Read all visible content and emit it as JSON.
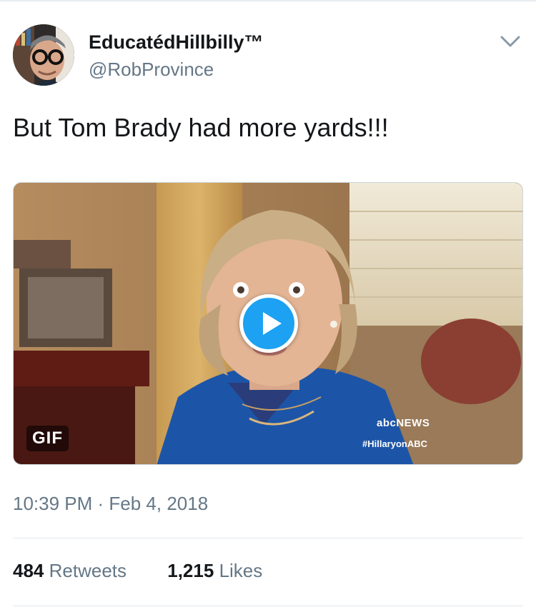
{
  "tweet": {
    "display_name": "EducatédHillbilly™",
    "handle": "@RobProvince",
    "text": "But Tom Brady had more yards!!!",
    "timestamp": "10:39 PM · Feb 4, 2018"
  },
  "media": {
    "type_badge": "GIF",
    "news_logo": "abcNEWS",
    "hashtag": "#HillaryonABC"
  },
  "stats": {
    "retweets_count": "484",
    "retweets_label": "Retweets",
    "likes_count": "1,215",
    "likes_label": "Likes"
  },
  "colors": {
    "accent": "#1da1f2",
    "secondary_text": "#657786",
    "primary_text": "#14171a",
    "divider": "#e1e8ed"
  },
  "icons": {
    "menu": "chevron-down-icon",
    "play": "play-icon"
  }
}
